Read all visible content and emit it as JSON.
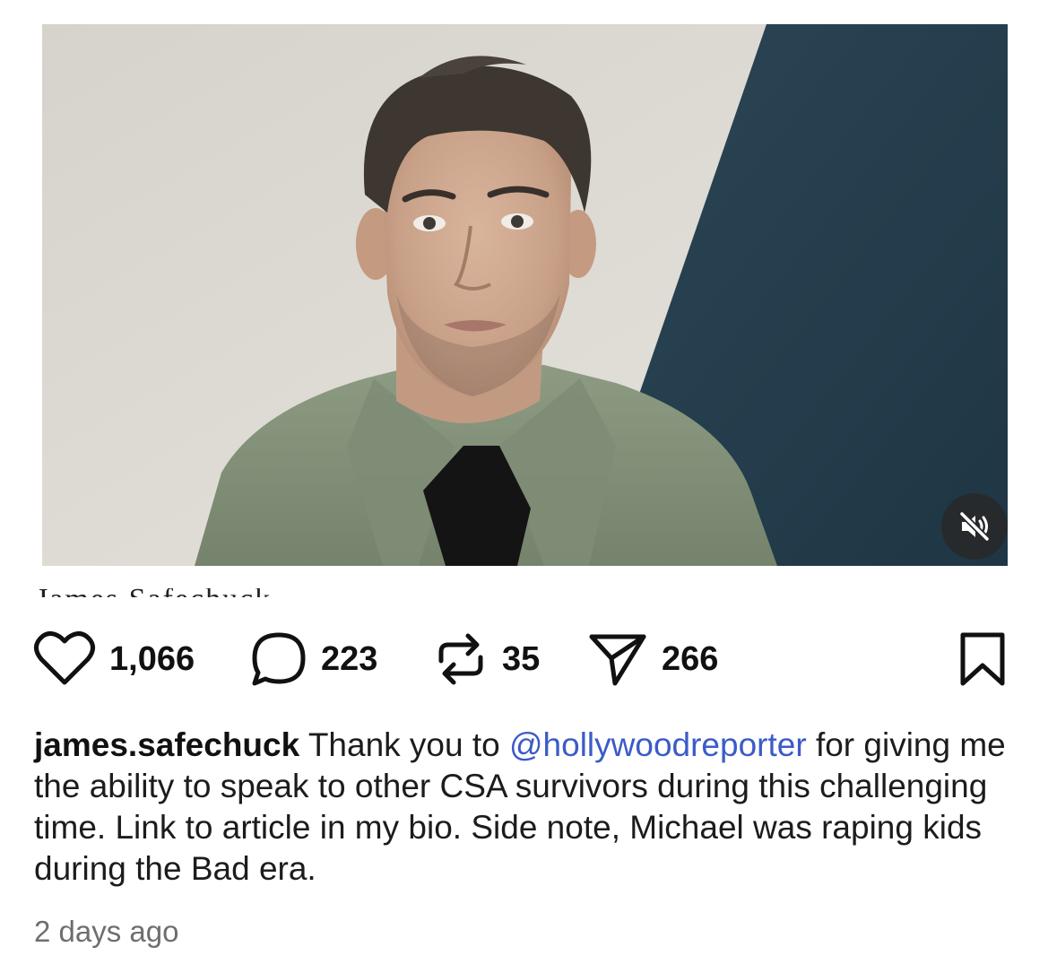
{
  "post": {
    "media_caption": "James Safechuck",
    "actions": {
      "likes": "1,066",
      "comments": "223",
      "reposts": "35",
      "shares": "266"
    },
    "caption": {
      "username": "james.safechuck",
      "text_before": "Thank you to",
      "mention": "@hollywoodreporter",
      "text_after": "for giving me the ability to speak to other CSA survivors during this challenging time. Link to article in my bio. Side note, Michael was raping kids during the Bad era."
    },
    "timestamp": "2 days ago"
  },
  "colors": {
    "mention": "#3b5bc7",
    "wall_dark": "#2e4a5a",
    "mute_button_bg": "#282828"
  },
  "icons": {
    "like": "heart-icon",
    "comment": "speech-bubble-icon",
    "repost": "repost-arrows-icon",
    "share": "paper-plane-icon",
    "save": "bookmark-icon",
    "mute": "speaker-muted-icon"
  }
}
